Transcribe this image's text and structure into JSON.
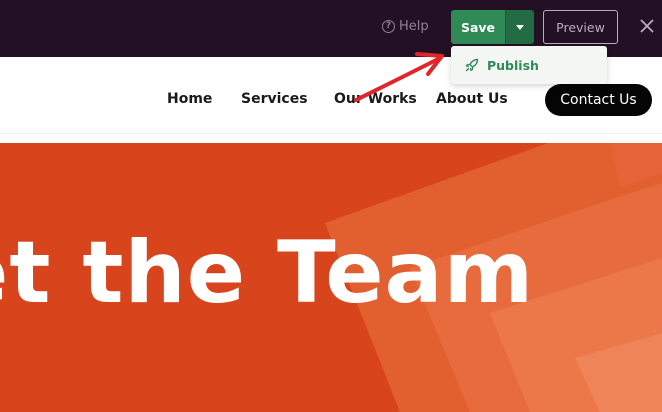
{
  "toolbar": {
    "help_label": "Help",
    "save_label": "Save",
    "preview_label": "Preview",
    "publish_label": "Publish"
  },
  "nav": {
    "items": [
      "Home",
      "Services",
      "Our Works",
      "About Us"
    ],
    "cta_label": "Contact Us"
  },
  "hero": {
    "title": "et the Team"
  },
  "colors": {
    "toolbar_bg": "#241024",
    "save_green": "#2f8a55",
    "hero_orange": "#d8441b",
    "annotation_red": "#e0262a"
  }
}
